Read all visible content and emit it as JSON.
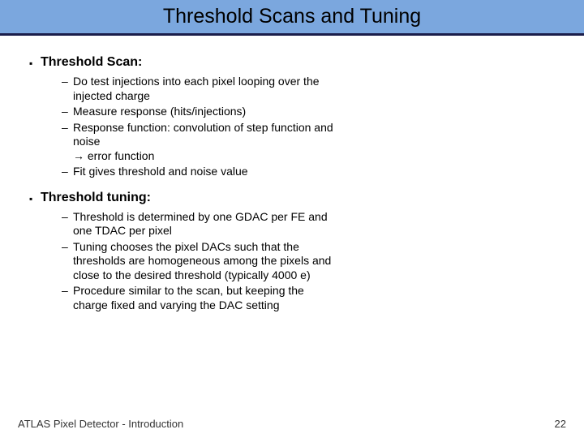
{
  "title": "Threshold Scans and Tuning",
  "sections": [
    {
      "heading": "Threshold Scan:",
      "items": [
        "Do test injections into each pixel looping over the injected charge",
        "Measure response (hits/injections)",
        "Response function: convolution of step function and noise\n→ error function",
        "Fit gives threshold and noise value"
      ]
    },
    {
      "heading": "Threshold tuning:",
      "items": [
        "Threshold is determined by one GDAC per FE and one TDAC per pixel",
        "Tuning chooses the pixel DACs such that the thresholds are homogeneous among the pixels and close to the desired threshold (typically 4000 e)",
        "Procedure similar to the scan, but keeping the charge fixed and varying the DAC setting"
      ]
    }
  ],
  "footer": {
    "left": "ATLAS Pixel Detector - Introduction",
    "right": "22"
  }
}
